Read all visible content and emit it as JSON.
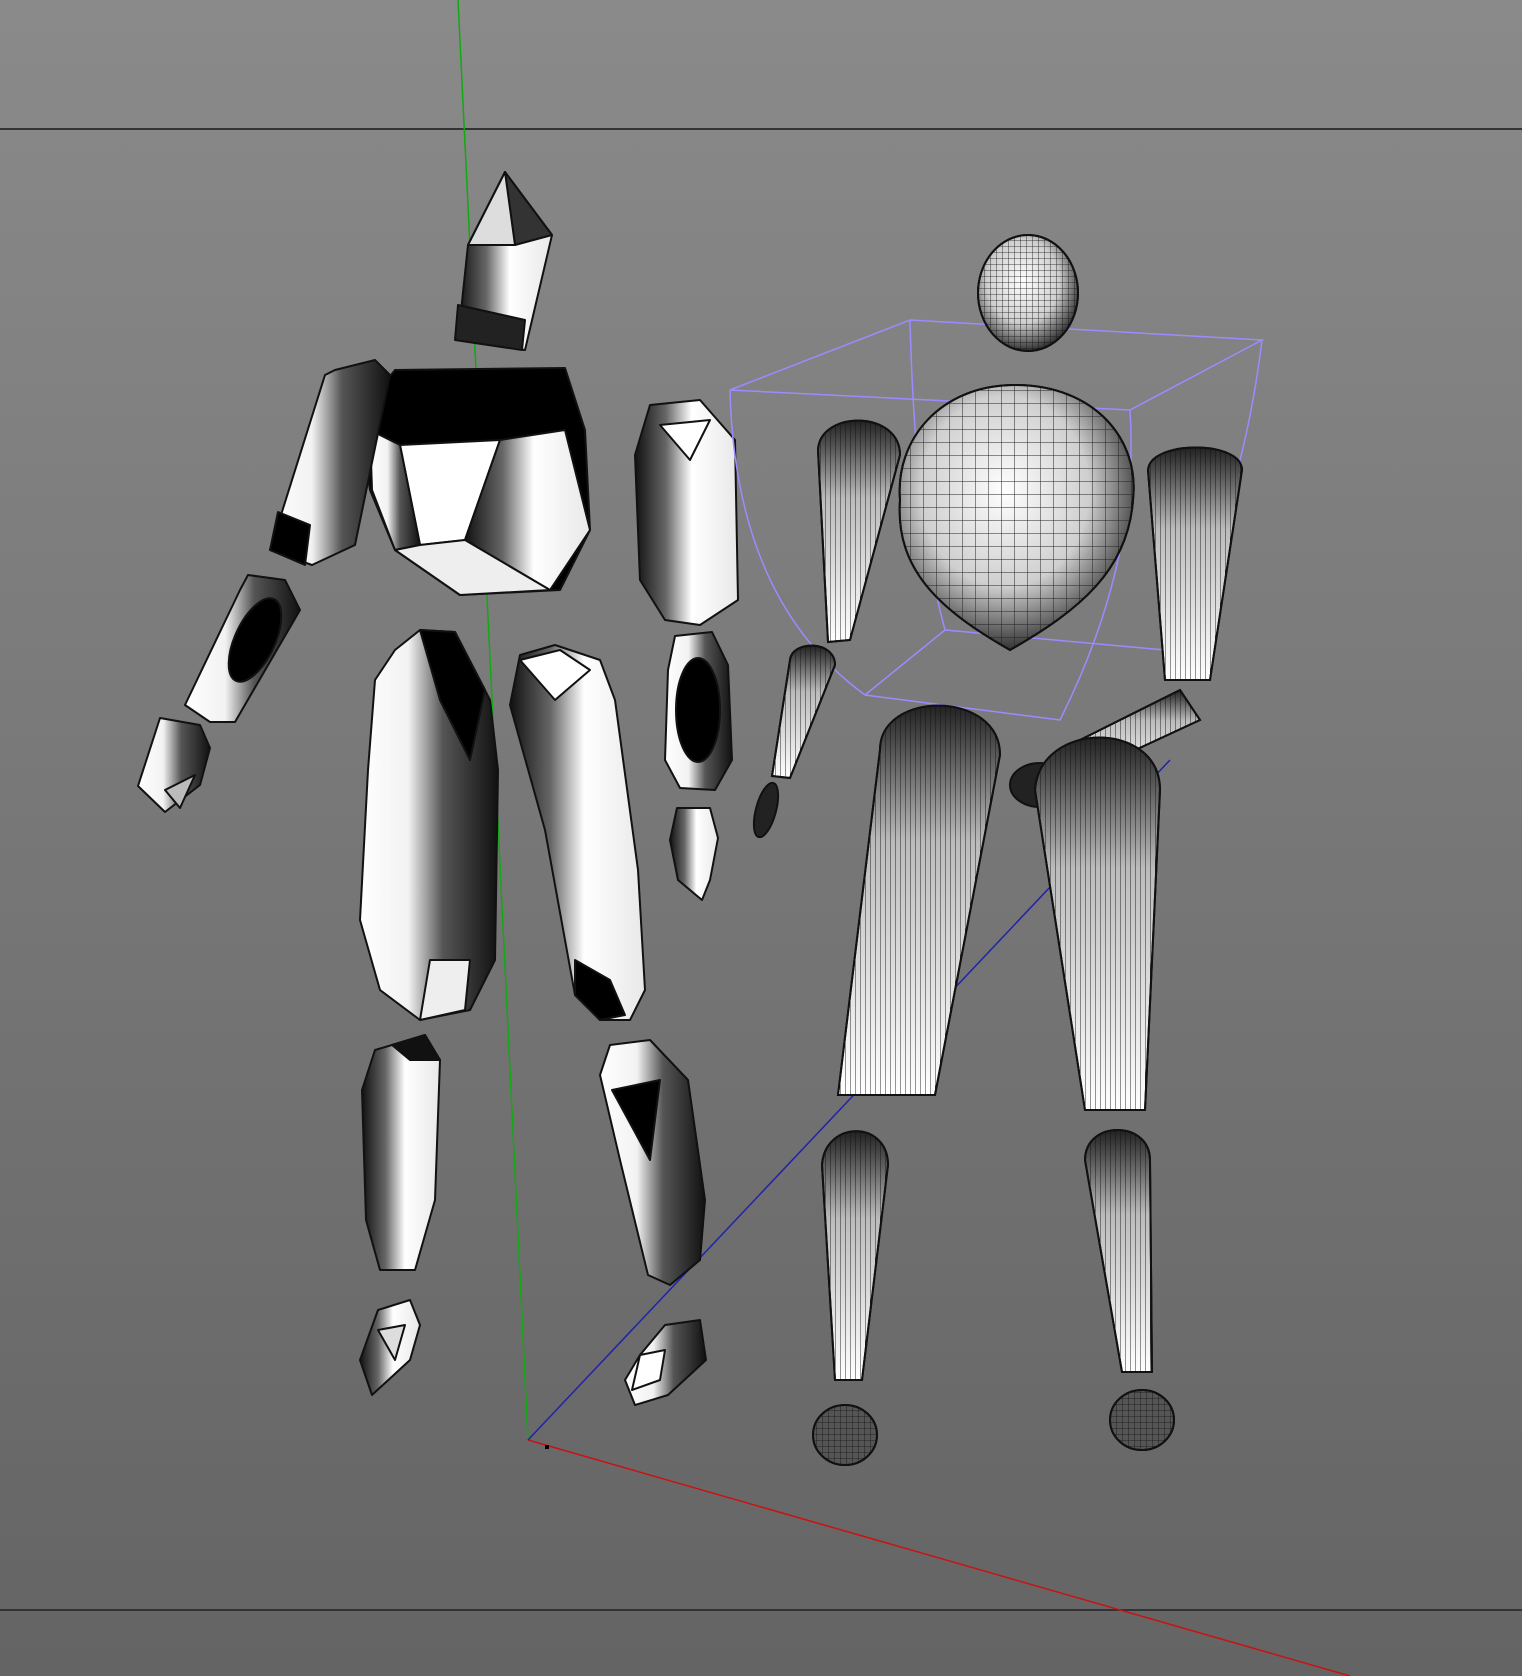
{
  "viewport": {
    "background_top": "#8a8a8a",
    "background_bottom": "#646464",
    "frame_line_color": "#333333"
  },
  "axes": {
    "x_axis_color": "#cc1111",
    "y_axis_color": "#11aa11",
    "z_axis_color": "#2222aa"
  },
  "selection_box": {
    "color": "#9a8cff"
  },
  "figures": {
    "low_poly_figure": {
      "shading": "chrome-faceted",
      "parts": 18
    },
    "wireframe_figure": {
      "shading": "wireframe-mesh",
      "parts": 16
    }
  }
}
